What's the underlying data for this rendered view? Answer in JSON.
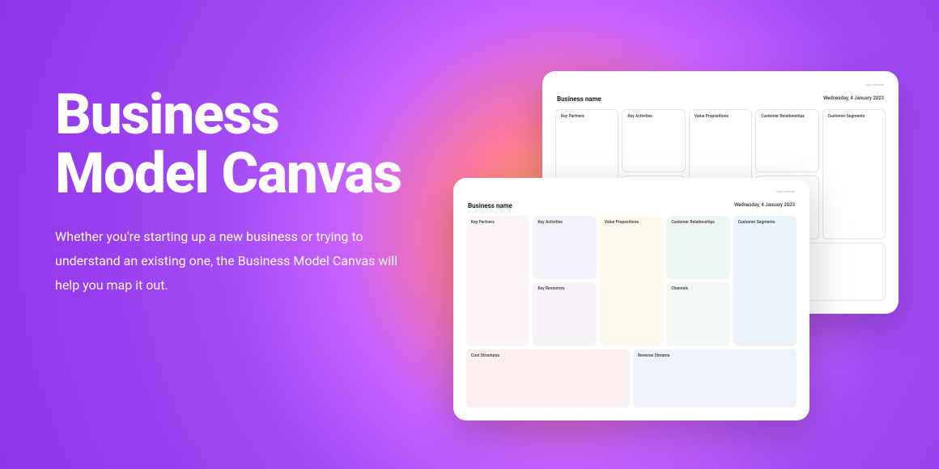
{
  "hero": {
    "title": "Business Model Canvas",
    "description": "Whether you're starting up a new business or trying to understand an existing one, the Business Model Canvas will help you map it out."
  },
  "canvas": {
    "title": "Business name",
    "date_label": "Last updated",
    "date": "Wednesday, 4 January 2023",
    "cells": {
      "key_partners": "Key Partners",
      "key_activities": "Key Activities",
      "value_propositions": "Value Propositions",
      "customer_relationships": "Customer Relationships",
      "customer_segments": "Customer Segments",
      "key_resources": "Key Resources",
      "channels": "Channels",
      "cost_structures": "Cost Structures",
      "revenue_streams": "Revenue Streams"
    }
  }
}
